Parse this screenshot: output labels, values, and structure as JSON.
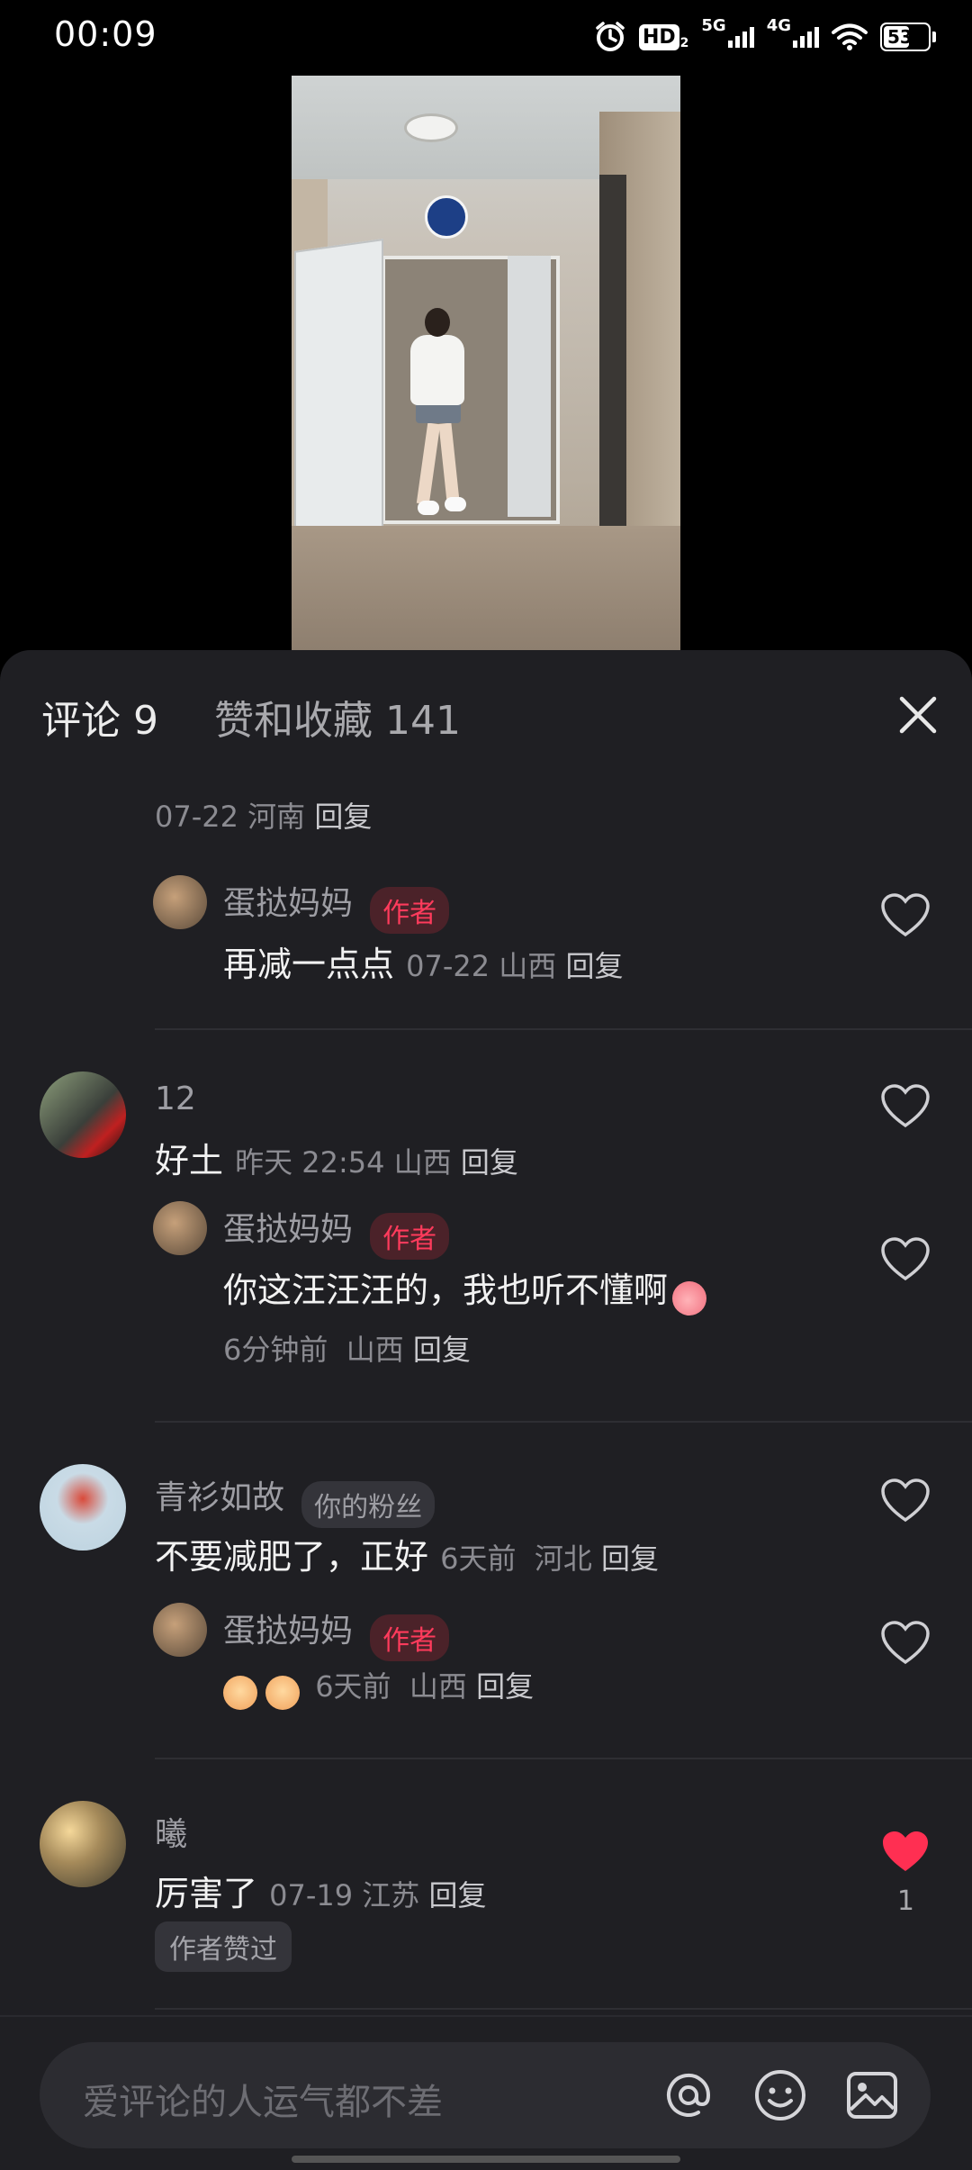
{
  "status_bar": {
    "time": "00:09",
    "hd_label": "HD",
    "hd_sub": "2",
    "net1": "5G",
    "net2": "4G",
    "battery": "53"
  },
  "tabs": {
    "comments": "评论 9",
    "likes": "赞和收藏 141"
  },
  "comments": {
    "top_meta": {
      "date": "07-22",
      "location": "河南",
      "reply": "回复"
    },
    "c1_reply": {
      "name": "蛋挞妈妈",
      "tag": "作者",
      "text": "再减一点点",
      "date": "07-22",
      "location": "山西",
      "reply": "回复"
    },
    "c2": {
      "name": "12",
      "text": "好土",
      "date": "昨天 22:54",
      "location": "山西",
      "reply": "回复"
    },
    "c2_reply": {
      "name": "蛋挞妈妈",
      "tag": "作者",
      "text": "你这汪汪汪的，我也听不懂啊",
      "date": "6分钟前",
      "location": "山西",
      "reply": "回复"
    },
    "c3": {
      "name": "青衫如故",
      "tag": "你的粉丝",
      "text": "不要减肥了，正好",
      "date": "6天前",
      "location": "河北",
      "reply": "回复"
    },
    "c3_reply": {
      "name": "蛋挞妈妈",
      "tag": "作者",
      "date": "6天前",
      "location": "山西",
      "reply": "回复"
    },
    "c4": {
      "name": "曦",
      "text": "厉害了",
      "date": "07-19",
      "location": "江苏",
      "reply": "回复",
      "like_count": "1",
      "badge": "作者赞过"
    }
  },
  "input": {
    "placeholder": "爱评论的人运气都不差"
  },
  "colors": {
    "panel_bg": "#1f1f23",
    "accent_red": "#ff3b5c",
    "muted": "#8b8b91"
  },
  "icons": [
    "alarm-icon",
    "wifi-icon",
    "close-icon",
    "heart-outline-icon",
    "heart-filled-icon",
    "at-icon",
    "emoji-icon",
    "image-icon"
  ]
}
